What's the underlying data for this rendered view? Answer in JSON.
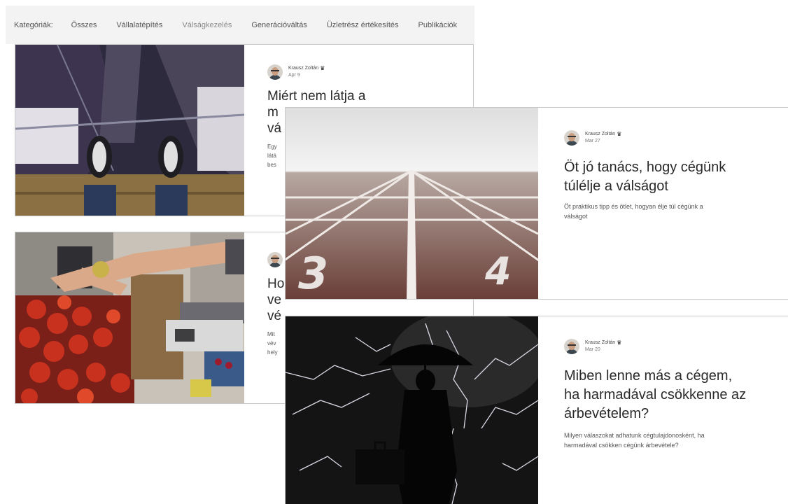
{
  "categories": {
    "label": "Kategóriák:",
    "items": [
      "Összes",
      "Vállalatépítés",
      "Válságkezelés",
      "Generációváltás",
      "Üzletrész értékesítés",
      "Publikációk"
    ],
    "active_index": 2
  },
  "author": {
    "name": "Krausz Zoltán",
    "crown_icon": "crown-icon"
  },
  "posts": [
    {
      "date": "Apr 9",
      "title_lines": [
        "Miért nem látja a",
        "m",
        "vá"
      ],
      "excerpt_lines": [
        "Egy",
        "látá",
        "bes"
      ],
      "image": "rooftop-feet-photo"
    },
    {
      "date": "",
      "title_lines": [
        "Ho",
        "ve",
        "vé"
      ],
      "excerpt_lines": [
        "Mit",
        "vév",
        "hely"
      ],
      "image": "market-fruit-photo"
    },
    {
      "date": "Mar 27",
      "title_lines": [
        "Öt jó tanács, hogy cégünk",
        "túlélje a válságot"
      ],
      "excerpt_lines": [
        "Öt praktikus tipp és ötlet, hogyan élje túl cégünk a",
        "válságot"
      ],
      "image": "running-track-photo",
      "lane_numbers": [
        "3",
        "4"
      ]
    },
    {
      "date": "Mar 20",
      "title_lines": [
        "Miben lenne más a cégem,",
        "ha harmadával csökkenne az",
        "árbevételem?"
      ],
      "excerpt_lines": [
        "Milyen válaszokat adhatunk cégtulajdonosként, ha",
        "harmadával csökken cégünk árbevétele?"
      ],
      "image": "storm-umbrella-photo"
    }
  ],
  "colors": {
    "category_bar_bg": "#f3f3f3",
    "active_category": "#8b8b8b",
    "card_border": "#c9c9c9"
  }
}
